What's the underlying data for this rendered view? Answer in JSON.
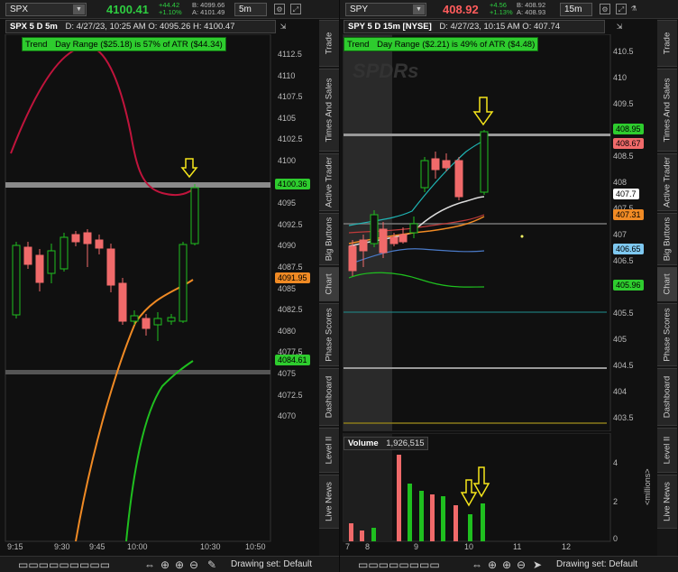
{
  "left": {
    "symbol": "SPX",
    "last": "4100.41",
    "change": "+44.42",
    "change_pct": "+1.10%",
    "bid": "B: 4099.66",
    "ask": "A: 4101.49",
    "timeframe": "5m",
    "title": "SPX 5 D 5m",
    "info": "D: 4/27/23, 10:25 AM  O: 4095.26  H: 4100.47",
    "trend_label": "Trend",
    "day_range": "Day Range ($25.18) is 57% of ATR ($44.34)",
    "y_ticks": [
      "4112.5",
      "4110",
      "4107.5",
      "4105",
      "4102.5",
      "4100",
      "4097.5",
      "4095",
      "4092.5",
      "4090",
      "4087.5",
      "4085",
      "4082.5",
      "4080",
      "4077.5",
      "4075",
      "4072.5",
      "4070"
    ],
    "x_ticks": [
      "9:15",
      "9:30",
      "9:45",
      "10:00",
      "10:30",
      "10:50"
    ],
    "price_labels": [
      {
        "text": "4100.36",
        "color": "#2ecc2e"
      },
      {
        "text": "4091.95",
        "color": "#f08a24"
      },
      {
        "text": "4084.61",
        "color": "#2ecc2e"
      }
    ],
    "drawing_set": "Drawing set: Default"
  },
  "right": {
    "symbol": "SPY",
    "last": "408.92",
    "change": "+4.56",
    "change_pct": "+1.13%",
    "bid": "B: 408.92",
    "ask": "A: 408.93",
    "timeframe": "15m",
    "title": "SPY 5 D 15m [NYSE]",
    "info": "D: 4/27/23, 10:15 AM  O: 407.74",
    "trend_label": "Trend",
    "day_range": "Day Range ($2.21) is 49% of ATR ($4.48)",
    "watermark": "SPDRs",
    "y_ticks": [
      "410.5",
      "410",
      "409.5",
      "409",
      "408.5",
      "408",
      "407.5",
      "407",
      "406.5",
      "406",
      "405.5",
      "405",
      "404.5",
      "404",
      "403.5"
    ],
    "price_labels": [
      {
        "text": "408.95",
        "color": "#2ecc2e"
      },
      {
        "text": "408.67",
        "color": "#f06a6a"
      },
      {
        "text": "407.7",
        "color": "#ffffff"
      },
      {
        "text": "407.31",
        "color": "#f08a24"
      },
      {
        "text": "406.65",
        "color": "#7ec8f0"
      },
      {
        "text": "405.96",
        "color": "#2ecc2e"
      }
    ],
    "volume_label": "Volume",
    "volume_value": "1,926,515",
    "vol_ticks": [
      "4",
      "2",
      "0"
    ],
    "vol_unit": "<millions>",
    "x_ticks": [
      "7",
      "8",
      "9",
      "10",
      "11",
      "12"
    ],
    "drawing_set": "Drawing set: Default"
  },
  "side_tabs": [
    "Trade",
    "Times And Sales",
    "Active Trader",
    "Big Buttons",
    "Chart",
    "Phase Scores",
    "Dashboard",
    "Level II",
    "Live News"
  ],
  "colors": {
    "up": "#2ecc2e",
    "down": "#f06a6a",
    "accent": "#2ecc2e"
  }
}
